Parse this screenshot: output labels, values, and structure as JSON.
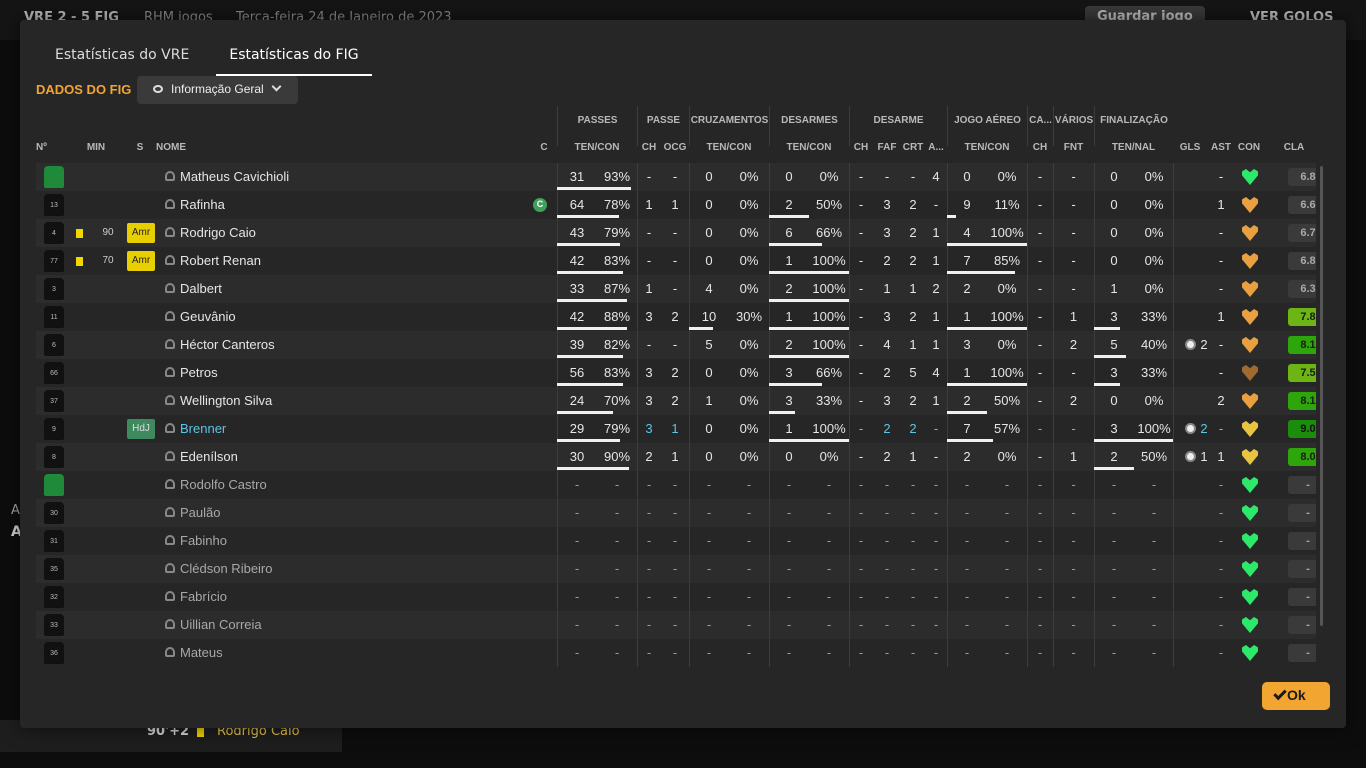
{
  "background": {
    "top_left": "VRE 2 - 5 FIG",
    "top_sub1": "RHM jogos",
    "top_sub2": "Terça-feira 24 de Janeiro de 2023",
    "save_label": "Guardar jogo",
    "goals_label": "VER GOLOS",
    "bottom_time": "90'+2",
    "bottom_name": "Rodrigo Caio",
    "left_a": "A",
    "left_a2": "A"
  },
  "tabs": [
    {
      "label": "Estatísticas do VRE"
    },
    {
      "label": "Estatísticas do FIG"
    }
  ],
  "section_title": "DADOS DO FIG",
  "view_dropdown": {
    "label": "Informação Geral"
  },
  "ok_label": "Ok",
  "groups": [
    "PASSES",
    "PASSE",
    "CRUZAMENTOS",
    "DESARMES",
    "DESARME",
    "JOGO AÉREO",
    "CA...",
    "VÁRIOS",
    "FINALIZAÇÃO"
  ],
  "columns": [
    "Nº",
    "MIN",
    "S",
    "NOME",
    "C",
    "TEN/CON",
    "CH",
    "OCG",
    "TEN/CON",
    "TEN/CON",
    "CH",
    "FAF",
    "CRT",
    "A...",
    "TEN/CON",
    "CH",
    "FNT",
    "TEN/NAL",
    "GLS",
    "AST",
    "CON",
    "CLA"
  ],
  "players": [
    {
      "num": "",
      "gk": true,
      "card": false,
      "min": "",
      "badge": "",
      "name": "Matheus Cavichioli",
      "sub": false,
      "hl": false,
      "capt": false,
      "pa": "31",
      "pp": "93%",
      "pch": "-",
      "pocg": "-",
      "cr": "0",
      "crp": "0%",
      "de": "0",
      "dep": "0%",
      "dch": "-",
      "faf": "-",
      "crt": "-",
      "aa": "4",
      "ja": "0",
      "jap": "0%",
      "ca": "-",
      "fnt": "-",
      "fin": "0",
      "finp": "0%",
      "gls": "",
      "ast": "-",
      "con": "green",
      "cla": "6.8",
      "clac": "gray",
      "bp": 0.93,
      "bcr": 0,
      "bde": 0,
      "bja": 0,
      "bfi": 0
    },
    {
      "num": "13",
      "gk": false,
      "card": false,
      "min": "",
      "badge": "",
      "name": "Rafinha",
      "sub": false,
      "hl": false,
      "capt": true,
      "pa": "64",
      "pp": "78%",
      "pch": "1",
      "pocg": "1",
      "cr": "0",
      "crp": "0%",
      "de": "2",
      "dep": "50%",
      "dch": "-",
      "faf": "3",
      "crt": "2",
      "aa": "-",
      "ja": "9",
      "jap": "11%",
      "ca": "-",
      "fnt": "-",
      "fin": "0",
      "finp": "0%",
      "gls": "",
      "ast": "1",
      "con": "orange",
      "cla": "6.6",
      "clac": "gray",
      "bp": 0.78,
      "bcr": 0,
      "bde": 0.5,
      "bja": 0.11,
      "bfi": 0
    },
    {
      "num": "4",
      "gk": false,
      "card": true,
      "min": "90",
      "badge": "Amr",
      "name": "Rodrigo Caio",
      "sub": false,
      "hl": false,
      "capt": false,
      "pa": "43",
      "pp": "79%",
      "pch": "-",
      "pocg": "-",
      "cr": "0",
      "crp": "0%",
      "de": "6",
      "dep": "66%",
      "dch": "-",
      "faf": "3",
      "crt": "2",
      "aa": "1",
      "ja": "4",
      "jap": "100%",
      "ca": "-",
      "fnt": "-",
      "fin": "0",
      "finp": "0%",
      "gls": "",
      "ast": "-",
      "con": "orange",
      "cla": "6.7",
      "clac": "gray",
      "bp": 0.79,
      "bcr": 0,
      "bde": 0.66,
      "bja": 1,
      "bfi": 0
    },
    {
      "num": "77",
      "gk": false,
      "card": true,
      "min": "70",
      "badge": "Amr",
      "name": "Robert Renan",
      "sub": false,
      "hl": false,
      "capt": false,
      "pa": "42",
      "pp": "83%",
      "pch": "-",
      "pocg": "-",
      "cr": "0",
      "crp": "0%",
      "de": "1",
      "dep": "100%",
      "dch": "-",
      "faf": "2",
      "crt": "2",
      "aa": "1",
      "ja": "7",
      "jap": "85%",
      "ca": "-",
      "fnt": "-",
      "fin": "0",
      "finp": "0%",
      "gls": "",
      "ast": "-",
      "con": "orange",
      "cla": "6.8",
      "clac": "gray",
      "bp": 0.83,
      "bcr": 0,
      "bde": 1,
      "bja": 0.85,
      "bfi": 0
    },
    {
      "num": "3",
      "gk": false,
      "card": false,
      "min": "",
      "badge": "",
      "name": "Dalbert",
      "sub": false,
      "hl": false,
      "capt": false,
      "pa": "33",
      "pp": "87%",
      "pch": "1",
      "pocg": "-",
      "cr": "4",
      "crp": "0%",
      "de": "2",
      "dep": "100%",
      "dch": "-",
      "faf": "1",
      "crt": "1",
      "aa": "2",
      "ja": "2",
      "jap": "0%",
      "ca": "-",
      "fnt": "-",
      "fin": "1",
      "finp": "0%",
      "gls": "",
      "ast": "-",
      "con": "orange",
      "cla": "6.3",
      "clac": "gray",
      "bp": 0.87,
      "bcr": 0,
      "bde": 1,
      "bja": 0,
      "bfi": 0
    },
    {
      "num": "11",
      "gk": false,
      "card": false,
      "min": "",
      "badge": "",
      "name": "Geuvânio",
      "sub": false,
      "hl": false,
      "capt": false,
      "pa": "42",
      "pp": "88%",
      "pch": "3",
      "pocg": "2",
      "cr": "10",
      "crp": "30%",
      "de": "1",
      "dep": "100%",
      "dch": "-",
      "faf": "3",
      "crt": "2",
      "aa": "1",
      "ja": "1",
      "jap": "100%",
      "ca": "-",
      "fnt": "1",
      "fin": "3",
      "finp": "33%",
      "gls": "",
      "ast": "1",
      "con": "orange",
      "cla": "7.8",
      "clac": "lg",
      "bp": 0.88,
      "bcr": 0.3,
      "bde": 1,
      "bja": 1,
      "bfi": 0.33
    },
    {
      "num": "6",
      "gk": false,
      "card": false,
      "min": "",
      "badge": "",
      "name": "Héctor Canteros",
      "sub": false,
      "hl": false,
      "capt": false,
      "pa": "39",
      "pp": "82%",
      "pch": "-",
      "pocg": "-",
      "cr": "5",
      "crp": "0%",
      "de": "2",
      "dep": "100%",
      "dch": "-",
      "faf": "4",
      "crt": "1",
      "aa": "1",
      "ja": "3",
      "jap": "0%",
      "ca": "-",
      "fnt": "2",
      "fin": "5",
      "finp": "40%",
      "gls": "2",
      "ast": "-",
      "con": "orange",
      "cla": "8.1",
      "clac": "g",
      "bp": 0.82,
      "bcr": 0,
      "bde": 1,
      "bja": 0,
      "bfi": 0.4
    },
    {
      "num": "66",
      "gk": false,
      "card": false,
      "min": "",
      "badge": "",
      "name": "Petros",
      "sub": false,
      "hl": false,
      "capt": false,
      "pa": "56",
      "pp": "83%",
      "pch": "3",
      "pocg": "2",
      "cr": "0",
      "crp": "0%",
      "de": "3",
      "dep": "66%",
      "dch": "-",
      "faf": "2",
      "crt": "5",
      "aa": "4",
      "ja": "1",
      "jap": "100%",
      "ca": "-",
      "fnt": "-",
      "fin": "3",
      "finp": "33%",
      "gls": "",
      "ast": "-",
      "con": "brown",
      "cla": "7.5",
      "clac": "lg",
      "bp": 0.83,
      "bcr": 0,
      "bde": 0.66,
      "bja": 1,
      "bfi": 0.33
    },
    {
      "num": "37",
      "gk": false,
      "card": false,
      "min": "",
      "badge": "",
      "name": "Wellington Silva",
      "sub": false,
      "hl": false,
      "capt": false,
      "pa": "24",
      "pp": "70%",
      "pch": "3",
      "pocg": "2",
      "cr": "1",
      "crp": "0%",
      "de": "3",
      "dep": "33%",
      "dch": "-",
      "faf": "3",
      "crt": "2",
      "aa": "1",
      "ja": "2",
      "jap": "50%",
      "ca": "-",
      "fnt": "2",
      "fin": "0",
      "finp": "0%",
      "gls": "",
      "ast": "2",
      "con": "orange",
      "cla": "8.1",
      "clac": "g",
      "bp": 0.7,
      "bcr": 0,
      "bde": 0.33,
      "bja": 0.5,
      "bfi": 0
    },
    {
      "num": "9",
      "gk": false,
      "card": false,
      "min": "",
      "badge": "HdJ",
      "name": "Brenner",
      "sub": false,
      "hl": true,
      "capt": false,
      "pa": "29",
      "pp": "79%",
      "pch": "3",
      "pocg": "1",
      "cr": "0",
      "crp": "0%",
      "de": "1",
      "dep": "100%",
      "dch": "-",
      "faf": "2",
      "crt": "2",
      "aa": "-",
      "ja": "7",
      "jap": "57%",
      "ca": "-",
      "fnt": "-",
      "fin": "3",
      "finp": "100%",
      "gls": "2",
      "ast": "-",
      "con": "yellow",
      "cla": "9.0",
      "clac": "dg",
      "bp": 0.79,
      "bcr": 0,
      "bde": 1,
      "bja": 0.57,
      "bfi": 1
    },
    {
      "num": "8",
      "gk": false,
      "card": false,
      "min": "",
      "badge": "",
      "name": "Edenílson",
      "sub": false,
      "hl": false,
      "capt": false,
      "pa": "30",
      "pp": "90%",
      "pch": "2",
      "pocg": "1",
      "cr": "0",
      "crp": "0%",
      "de": "0",
      "dep": "0%",
      "dch": "-",
      "faf": "2",
      "crt": "1",
      "aa": "-",
      "ja": "2",
      "jap": "0%",
      "ca": "-",
      "fnt": "1",
      "fin": "2",
      "finp": "50%",
      "gls": "1",
      "ast": "1",
      "con": "yellow",
      "cla": "8.0",
      "clac": "g",
      "bp": 0.9,
      "bcr": 0,
      "bde": 0,
      "bja": 0,
      "bfi": 0.5
    },
    {
      "num": "",
      "gk": true,
      "card": false,
      "min": "",
      "badge": "",
      "name": "Rodolfo Castro",
      "sub": true,
      "hl": false,
      "capt": false,
      "pa": "-",
      "pp": "-",
      "pch": "-",
      "pocg": "-",
      "cr": "-",
      "crp": "-",
      "de": "-",
      "dep": "-",
      "dch": "-",
      "faf": "-",
      "crt": "-",
      "aa": "-",
      "ja": "-",
      "jap": "-",
      "ca": "-",
      "fnt": "-",
      "fin": "-",
      "finp": "-",
      "gls": "",
      "ast": "-",
      "con": "green",
      "cla": "-",
      "clac": "gray",
      "bp": 0,
      "bcr": 0,
      "bde": 0,
      "bja": 0,
      "bfi": 0
    },
    {
      "num": "30",
      "gk": false,
      "card": false,
      "min": "",
      "badge": "",
      "name": "Paulão",
      "sub": true,
      "hl": false,
      "capt": false,
      "pa": "-",
      "pp": "-",
      "pch": "-",
      "pocg": "-",
      "cr": "-",
      "crp": "-",
      "de": "-",
      "dep": "-",
      "dch": "-",
      "faf": "-",
      "crt": "-",
      "aa": "-",
      "ja": "-",
      "jap": "-",
      "ca": "-",
      "fnt": "-",
      "fin": "-",
      "finp": "-",
      "gls": "",
      "ast": "-",
      "con": "green",
      "cla": "-",
      "clac": "gray",
      "bp": 0,
      "bcr": 0,
      "bde": 0,
      "bja": 0,
      "bfi": 0
    },
    {
      "num": "31",
      "gk": false,
      "card": false,
      "min": "",
      "badge": "",
      "name": "Fabinho",
      "sub": true,
      "hl": false,
      "capt": false,
      "pa": "-",
      "pp": "-",
      "pch": "-",
      "pocg": "-",
      "cr": "-",
      "crp": "-",
      "de": "-",
      "dep": "-",
      "dch": "-",
      "faf": "-",
      "crt": "-",
      "aa": "-",
      "ja": "-",
      "jap": "-",
      "ca": "-",
      "fnt": "-",
      "fin": "-",
      "finp": "-",
      "gls": "",
      "ast": "-",
      "con": "green",
      "cla": "-",
      "clac": "gray",
      "bp": 0,
      "bcr": 0,
      "bde": 0,
      "bja": 0,
      "bfi": 0
    },
    {
      "num": "35",
      "gk": false,
      "card": false,
      "min": "",
      "badge": "",
      "name": "Clédson Ribeiro",
      "sub": true,
      "hl": false,
      "capt": false,
      "pa": "-",
      "pp": "-",
      "pch": "-",
      "pocg": "-",
      "cr": "-",
      "crp": "-",
      "de": "-",
      "dep": "-",
      "dch": "-",
      "faf": "-",
      "crt": "-",
      "aa": "-",
      "ja": "-",
      "jap": "-",
      "ca": "-",
      "fnt": "-",
      "fin": "-",
      "finp": "-",
      "gls": "",
      "ast": "-",
      "con": "green",
      "cla": "-",
      "clac": "gray",
      "bp": 0,
      "bcr": 0,
      "bde": 0,
      "bja": 0,
      "bfi": 0
    },
    {
      "num": "32",
      "gk": false,
      "card": false,
      "min": "",
      "badge": "",
      "name": "Fabrício",
      "sub": true,
      "hl": false,
      "capt": false,
      "pa": "-",
      "pp": "-",
      "pch": "-",
      "pocg": "-",
      "cr": "-",
      "crp": "-",
      "de": "-",
      "dep": "-",
      "dch": "-",
      "faf": "-",
      "crt": "-",
      "aa": "-",
      "ja": "-",
      "jap": "-",
      "ca": "-",
      "fnt": "-",
      "fin": "-",
      "finp": "-",
      "gls": "",
      "ast": "-",
      "con": "green",
      "cla": "-",
      "clac": "gray",
      "bp": 0,
      "bcr": 0,
      "bde": 0,
      "bja": 0,
      "bfi": 0
    },
    {
      "num": "33",
      "gk": false,
      "card": false,
      "min": "",
      "badge": "",
      "name": "Uillian Correia",
      "sub": true,
      "hl": false,
      "capt": false,
      "pa": "-",
      "pp": "-",
      "pch": "-",
      "pocg": "-",
      "cr": "-",
      "crp": "-",
      "de": "-",
      "dep": "-",
      "dch": "-",
      "faf": "-",
      "crt": "-",
      "aa": "-",
      "ja": "-",
      "jap": "-",
      "ca": "-",
      "fnt": "-",
      "fin": "-",
      "finp": "-",
      "gls": "",
      "ast": "-",
      "con": "green",
      "cla": "-",
      "clac": "gray",
      "bp": 0,
      "bcr": 0,
      "bde": 0,
      "bja": 0,
      "bfi": 0
    },
    {
      "num": "36",
      "gk": false,
      "card": false,
      "min": "",
      "badge": "",
      "name": "Mateus",
      "sub": true,
      "hl": false,
      "capt": false,
      "pa": "-",
      "pp": "-",
      "pch": "-",
      "pocg": "-",
      "cr": "-",
      "crp": "-",
      "de": "-",
      "dep": "-",
      "dch": "-",
      "faf": "-",
      "crt": "-",
      "aa": "-",
      "ja": "-",
      "jap": "-",
      "ca": "-",
      "fnt": "-",
      "fin": "-",
      "finp": "-",
      "gls": "",
      "ast": "-",
      "con": "green",
      "cla": "-",
      "clac": "gray",
      "bp": 0,
      "bcr": 0,
      "bde": 0,
      "bja": 0,
      "bfi": 0
    }
  ],
  "colors": {
    "accent": "#f2a530",
    "highlight": "#5bc6e8",
    "green_heart": "#2ee86a",
    "orange_heart": "#e8a040",
    "yellow_heart": "#e8c440",
    "brown_heart": "#a06a30"
  }
}
